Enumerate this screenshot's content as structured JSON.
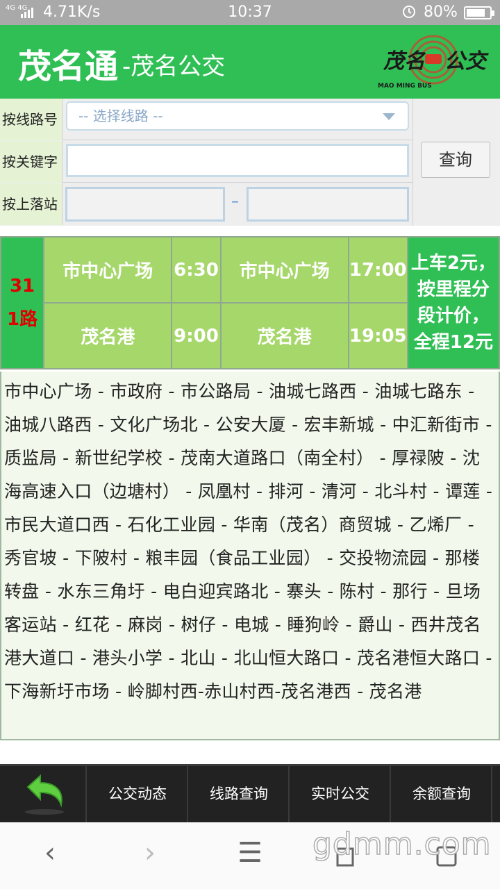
{
  "status_bar": {
    "network": "4G 4G",
    "speed": "4.71K/s",
    "time": "10:37",
    "battery": "80%",
    "battery_level": 0.8
  },
  "header": {
    "brand": "茂名通",
    "subtitle": "-茂名公交",
    "logo_text": "茂名公交",
    "logo_subtext": "MAO MING BUS",
    "bg_color": "#2fbf55"
  },
  "search_form": {
    "by_route_label": "按线路号",
    "route_select_value": "-- 选择线路 --",
    "by_keyword_label": "按关键字",
    "keyword_value": "",
    "by_stops_label": "按上落站",
    "from_value": "",
    "separator": "–",
    "to_value": "",
    "search_button": "查询"
  },
  "route": {
    "number": "311路",
    "rows": [
      {
        "stop1": "市中心广场",
        "time1": "6:30",
        "stop2": "市中心广场",
        "time2": "17:00"
      },
      {
        "stop1": "茂名港",
        "time1": "9:00",
        "stop2": "茂名港",
        "time2": "19:05"
      }
    ],
    "fare": "上车2元，按里程分段计价，全程12元",
    "stops_text": "市中心广场 - 市政府 - 市公路局 - 油城七路西 - 油城七路东 - 油城八路西 - 文化广场北 - 公安大厦 - 宏丰新城 - 中汇新街市 - 质监局 - 新世纪学校 - 茂南大道路口（南全村） - 厚禄陂 - 沈海高速入口（边塘村） - 凤凰村 - 排河 - 清河 - 北斗村 - 谭莲 - 市民大道口西 - 石化工业园 - 华南（茂名）商贸城 - 乙烯厂 - 秀官坡 - 下陂村 - 粮丰园（食品工业园） - 交投物流园 - 那楼转盘 - 水东三角圩 - 电白迎宾路北 - 寨头 - 陈村 - 那行 - 旦场客运站 - 红花 - 麻岗 - 树仔 - 电城 - 睡狗岭 - 爵山 - 西井茂名港大道口 - 港头小学 - 北山 - 北山恒大路口 - 茂名港恒大路口 - 下海新圩市场 - 岭脚村西-赤山村西-茂名港西 - 茂名港"
  },
  "app_nav": {
    "items": [
      "公交动态",
      "线路查询",
      "实时公交",
      "余额查询"
    ]
  },
  "browser_bar": {
    "back": "‹",
    "forward": "›",
    "menu": "☰",
    "watermark": "gdmm.com"
  }
}
